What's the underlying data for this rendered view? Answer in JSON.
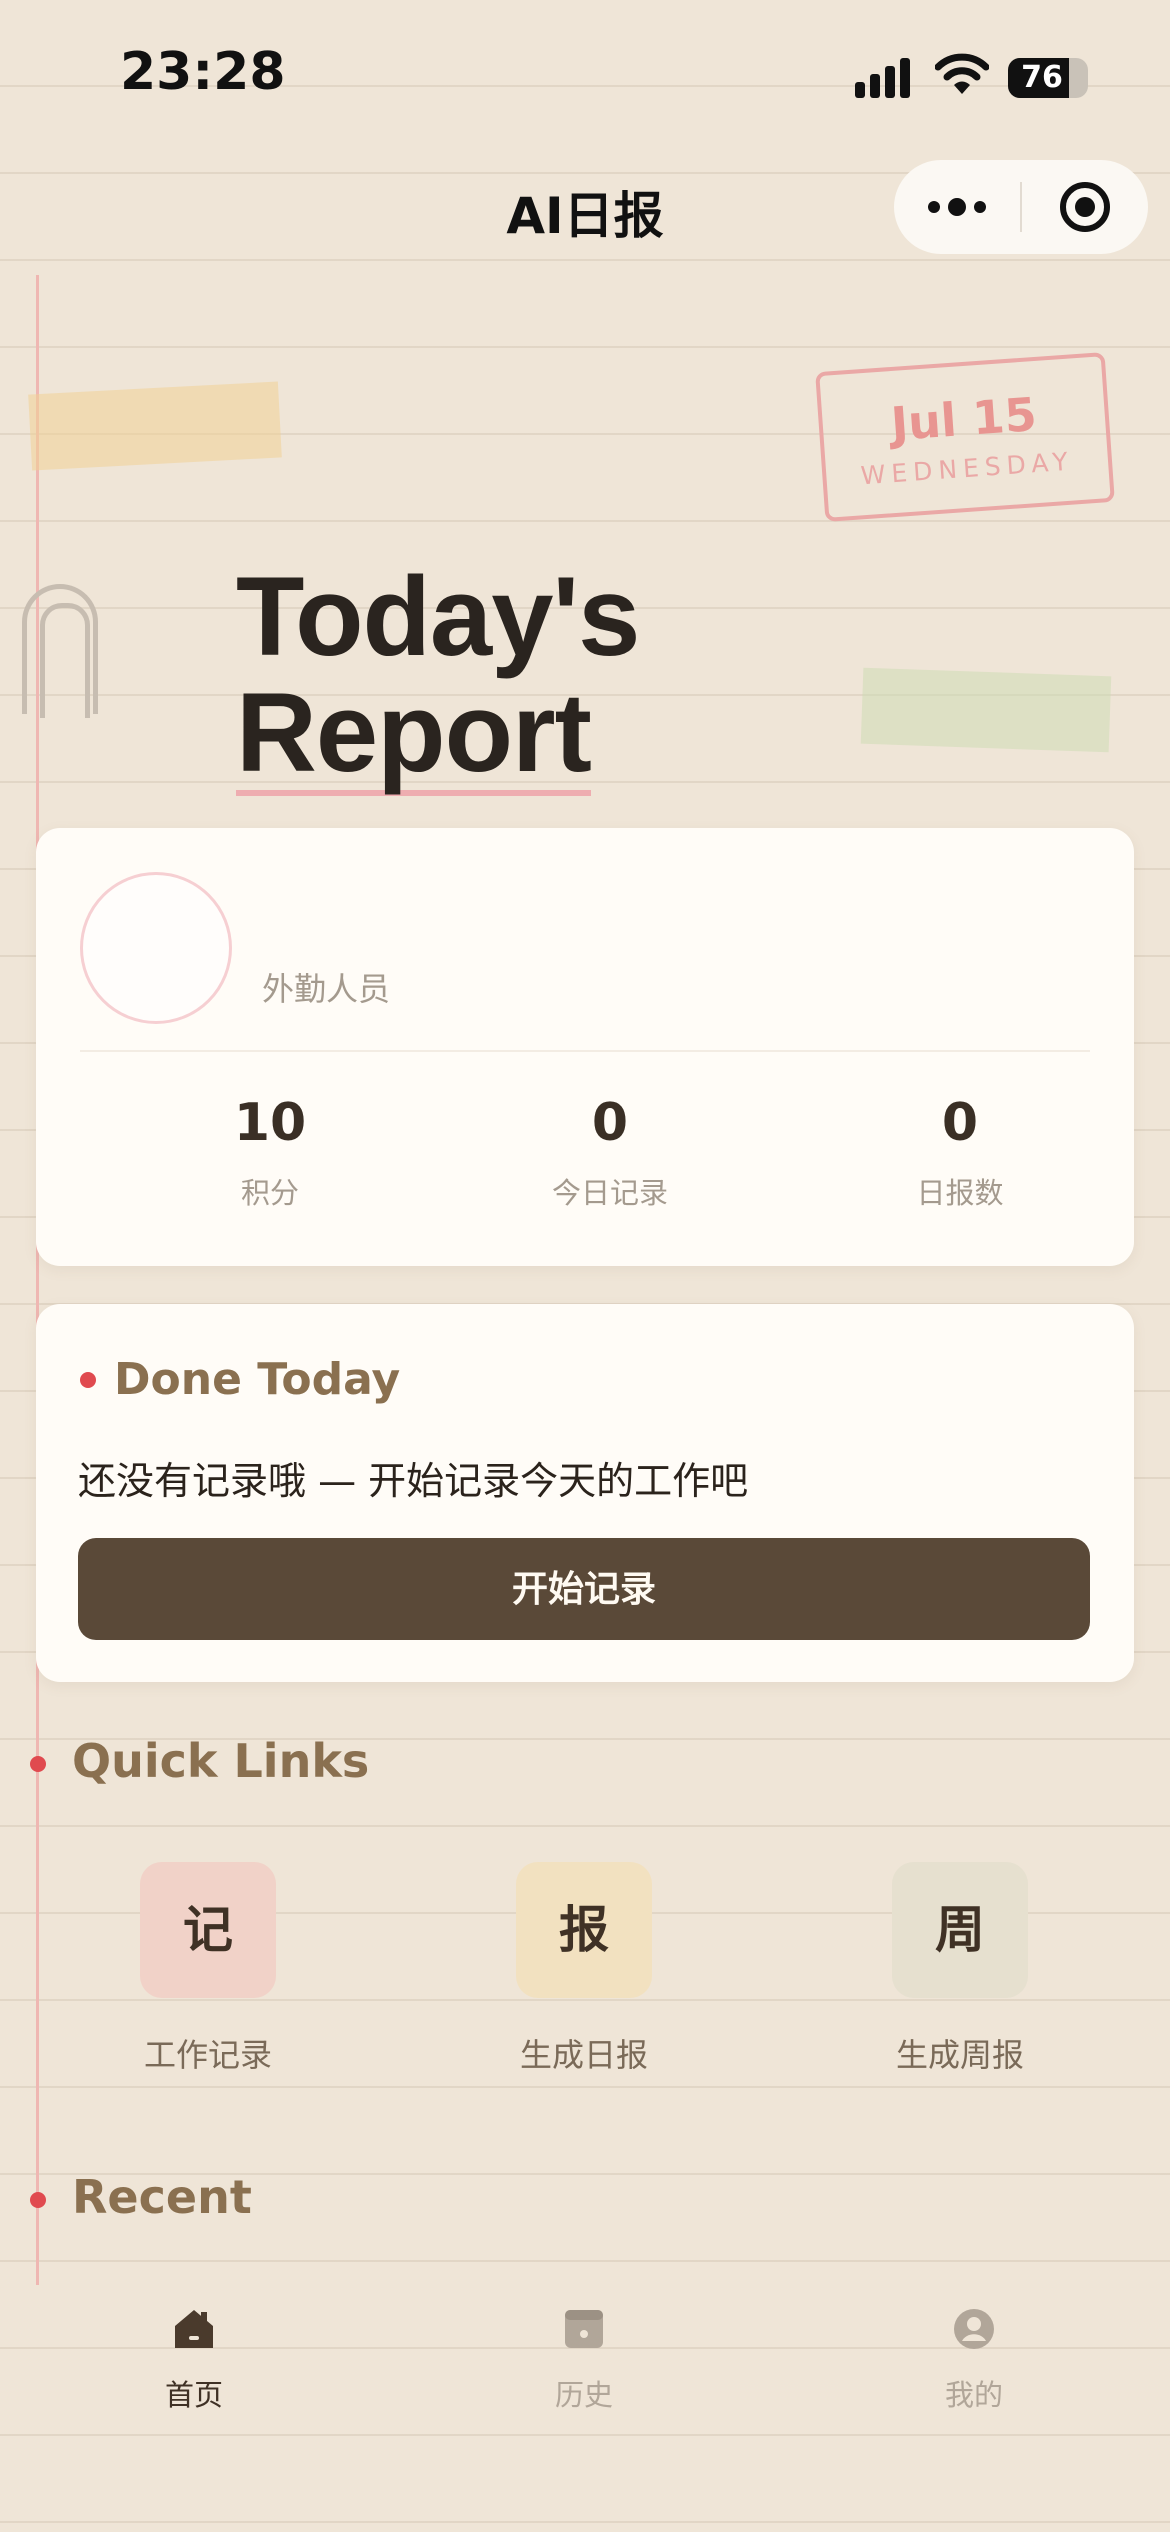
{
  "status_bar": {
    "time": "23:28",
    "battery": "76",
    "battery_level": 0.76
  },
  "nav": {
    "title": "AI日报"
  },
  "stamp": {
    "date": "Jul 15",
    "weekday": "WEDNESDAY"
  },
  "hero": {
    "line1": "Today's",
    "line2": "Report"
  },
  "profile": {
    "role": "外勤人员",
    "stats": [
      {
        "value": "10",
        "label": "积分"
      },
      {
        "value": "0",
        "label": "今日记录"
      },
      {
        "value": "0",
        "label": "日报数"
      }
    ]
  },
  "done_today": {
    "title": "Done Today",
    "empty_text": "还没有记录哦 — 开始记录今天的工作吧",
    "button_label": "开始记录"
  },
  "quick_links": {
    "title": "Quick Links",
    "items": [
      {
        "glyph": "记",
        "label": "工作记录",
        "color": "#f1d2c8"
      },
      {
        "glyph": "报",
        "label": "生成日报",
        "color": "#f2e1c0"
      },
      {
        "glyph": "周",
        "label": "生成周报",
        "color": "#e6e0cf"
      }
    ]
  },
  "recent": {
    "title": "Recent"
  },
  "tab_bar": {
    "items": [
      {
        "label": "首页",
        "icon": "home-icon",
        "active": true
      },
      {
        "label": "历史",
        "icon": "history-icon",
        "active": false
      },
      {
        "label": "我的",
        "icon": "profile-icon",
        "active": false
      }
    ]
  },
  "colors": {
    "background": "#efe5d7",
    "accent_dot": "#e04a4f",
    "primary_button": "#5a4938",
    "section_title": "#8a7050"
  }
}
